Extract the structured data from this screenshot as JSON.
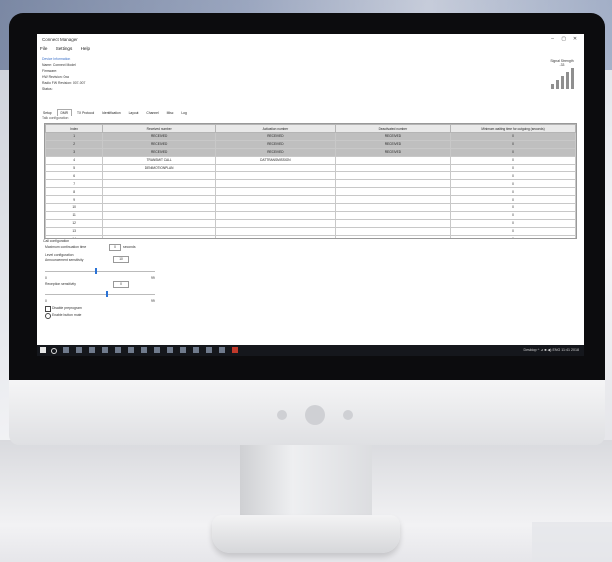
{
  "window": {
    "title": "Connect Manager",
    "controls": [
      "–",
      "▢",
      "✕"
    ]
  },
  "menu": [
    "File",
    "Settings",
    "Help"
  ],
  "device_info": {
    "header": "Device Information",
    "rows": [
      "Name:      Connect Model",
      "Firmware:",
      "HW Revision: 0xa",
      "Radio FW Revision:    007-007",
      "Status:"
    ]
  },
  "signal": {
    "label": "Signal Strength",
    "value": "-33"
  },
  "tabs": [
    "Setup",
    "DMR",
    "TX Protocol",
    "Identification",
    "Layout",
    "Channel",
    "Misc",
    "Log"
  ],
  "active_tab": "DMR",
  "grid": {
    "title": "Talk configuration",
    "columns": [
      "Index",
      "Received number",
      "Activation number",
      "Deactivated number",
      "Minimum waiting time for outgoing (seconds)"
    ],
    "rows": [
      [
        "1",
        "RECEIVED",
        "RECEIVED",
        "RECEIVED",
        "0",
        true
      ],
      [
        "2",
        "RECEIVED",
        "RECEIVED",
        "RECEIVED",
        "0",
        true
      ],
      [
        "3",
        "RECEIVED",
        "RECEIVED",
        "RECEIVED",
        "0",
        true
      ],
      [
        "4",
        "TRANSMIT CALL",
        "DATTRANSMISSION",
        "",
        "0",
        false
      ],
      [
        "5",
        "DENIMOTIONPLAN",
        "",
        "",
        "0",
        false
      ],
      [
        "6",
        "",
        "",
        "",
        "0",
        false
      ],
      [
        "7",
        "",
        "",
        "",
        "0",
        false
      ],
      [
        "8",
        "",
        "",
        "",
        "0",
        false
      ],
      [
        "9",
        "",
        "",
        "",
        "0",
        false
      ],
      [
        "10",
        "",
        "",
        "",
        "0",
        false
      ],
      [
        "11",
        "",
        "",
        "",
        "0",
        false
      ],
      [
        "12",
        "",
        "",
        "",
        "0",
        false
      ],
      [
        "13",
        "",
        "",
        "",
        "0",
        false
      ],
      [
        "14",
        "",
        "",
        "",
        "0",
        false
      ],
      [
        "15",
        "",
        "",
        "",
        "0",
        false
      ]
    ]
  },
  "lower": {
    "config_title": "Call configuration",
    "max_channel_label": "Maximum continuation time",
    "max_channel_value": "0",
    "max_channel_unit": "seconds",
    "level_title": "Level configuration",
    "vol_label": "Announcement sensitivity",
    "vol_value": "10",
    "vol_slider": 0.45,
    "ptt_label": "Reception sensitivity",
    "ptt_value": "0",
    "ptt_slider": 0.55,
    "min1": "0",
    "max1": "99",
    "min2": "0",
    "max2": "99",
    "check_label": "Disable preprogram",
    "radio_label": "Enable button mute"
  },
  "taskbar": {
    "tray_text": "Desktop  ^  ⊿  ■  ◀)  ENG  11:41  2018"
  }
}
